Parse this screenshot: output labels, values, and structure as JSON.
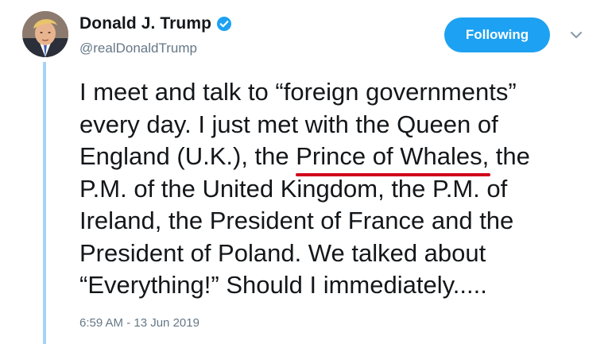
{
  "tweet": {
    "author": {
      "display_name": "Donald J. Trump",
      "handle": "@realDonaldTrump",
      "verified": true,
      "avatar_icon": "profile-photo"
    },
    "follow_button_label": "Following",
    "menu_icon": "chevron-down-icon",
    "text_lines": {
      "line1": "I meet and talk to “foreign governments”",
      "line2": "every day. I just met with the Queen of",
      "line3_pre": "England (U.K.), the ",
      "line3_highlight": "Prince of Whales,",
      "line3_post": " the",
      "line4": "P.M. of the United Kingdom, the P.M. of",
      "line5": "Ireland, the President of France and the",
      "line6": "President of Poland. We talked about",
      "line7": "“Everything!” Should I immediately....."
    },
    "timestamp": "6:59 AM - 13 Jun 2019"
  },
  "colors": {
    "accent": "#1da1f2",
    "thread_line": "#a4d3f7",
    "highlight_underline": "#d0021b",
    "secondary_text": "#657786"
  }
}
